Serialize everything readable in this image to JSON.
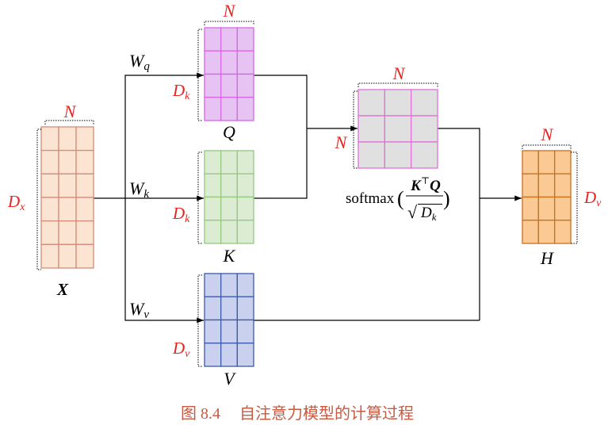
{
  "colors": {
    "ink": "#000000",
    "dimension_label": "#e8231f",
    "caption": "#c65a43"
  },
  "matrices": {
    "x": {
      "name": "X",
      "width_label": "N",
      "height_label": {
        "base": "D",
        "sub": "x"
      },
      "fill": "#fbe4d1",
      "stroke": "#d48a7a"
    },
    "q": {
      "name": "Q",
      "width_label": "N",
      "height_label": {
        "base": "D",
        "sub": "k"
      },
      "fill": "#e6c3f3",
      "stroke": "#d667e3"
    },
    "k": {
      "name": "K",
      "height_label": {
        "base": "D",
        "sub": "k"
      },
      "fill": "#dbecd3",
      "stroke": "#96c882"
    },
    "v": {
      "name": "V",
      "height_label": {
        "base": "D",
        "sub": "v"
      },
      "fill": "#c9d1ef",
      "stroke": "#3e5aa8"
    },
    "attention": {
      "width_label": "N",
      "height_label": "N",
      "fill": "#e0e0e0",
      "stroke": "#e070d8",
      "formula": {
        "function": "softmax",
        "open_paren": "(",
        "numerator": {
          "left": "K",
          "transpose": "⊤",
          "right": "Q"
        },
        "denominator": {
          "radical": "√",
          "base": "D",
          "sub": "k"
        },
        "close_paren": ")"
      }
    },
    "h": {
      "name": "H",
      "width_label": "N",
      "height_label": {
        "base": "D",
        "sub": "v"
      },
      "fill": "#fac994",
      "stroke": "#c9711f"
    }
  },
  "weights": {
    "q": {
      "base": "W",
      "sub": "q"
    },
    "k": {
      "base": "W",
      "sub": "k"
    },
    "v": {
      "base": "W",
      "sub": "v"
    }
  },
  "caption": {
    "number": "图 8.4",
    "title": "自注意力模型的计算过程"
  }
}
